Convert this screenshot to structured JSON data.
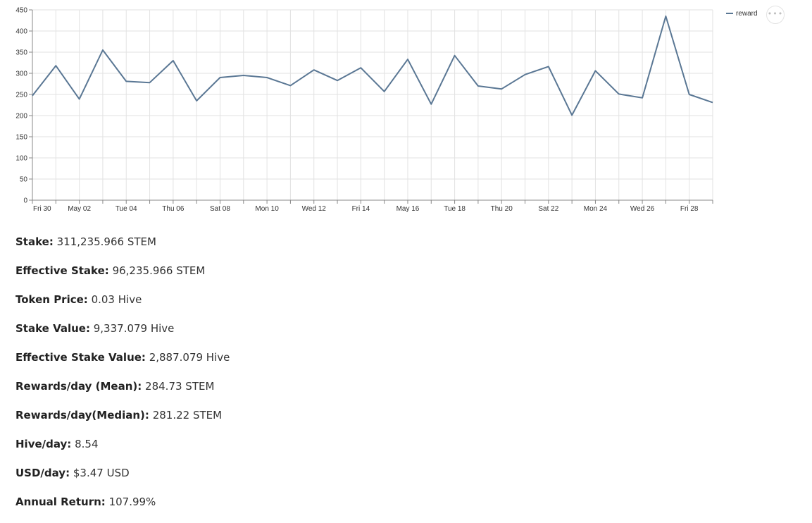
{
  "chart_data": {
    "type": "line",
    "x_tick_labels": [
      "Fri 30",
      "May 02",
      "Tue 04",
      "Thu 06",
      "Sat 08",
      "Mon 10",
      "Wed 12",
      "Fri 14",
      "May 16",
      "Tue 18",
      "Thu 20",
      "Sat 22",
      "Mon 24",
      "Wed 26",
      "Fri 28"
    ],
    "y_ticks": [
      0,
      50,
      100,
      150,
      200,
      250,
      300,
      350,
      400,
      450
    ],
    "ylim": [
      0,
      450
    ],
    "grid": true,
    "legend_position": "top-right",
    "series": [
      {
        "name": "reward",
        "color": "#5a7794",
        "values": [
          247,
          318,
          239,
          355,
          281,
          278,
          330,
          235,
          290,
          295,
          290,
          271,
          308,
          283,
          313,
          257,
          333,
          227,
          342,
          270,
          263,
          297,
          316,
          201,
          306,
          251,
          242,
          435,
          250,
          231
        ]
      }
    ]
  },
  "menu": {
    "icon": "more-horizontal-icon",
    "label": "•••"
  },
  "stats": [
    {
      "label": "Stake:",
      "value": "311,235.966 STEM"
    },
    {
      "label": "Effective Stake:",
      "value": "96,235.966 STEM"
    },
    {
      "label": "Token Price:",
      "value": "0.03 Hive"
    },
    {
      "label": "Stake Value:",
      "value": "9,337.079 Hive"
    },
    {
      "label": "Effective Stake Value:",
      "value": "2,887.079 Hive"
    },
    {
      "label": "Rewards/day (Mean):",
      "value": "284.73 STEM"
    },
    {
      "label": "Rewards/day(Median):",
      "value": "281.22 STEM"
    },
    {
      "label": "Hive/day:",
      "value": "8.54"
    },
    {
      "label": "USD/day:",
      "value": "$3.47 USD"
    },
    {
      "label": "Annual Return:",
      "value": "107.99%"
    }
  ]
}
